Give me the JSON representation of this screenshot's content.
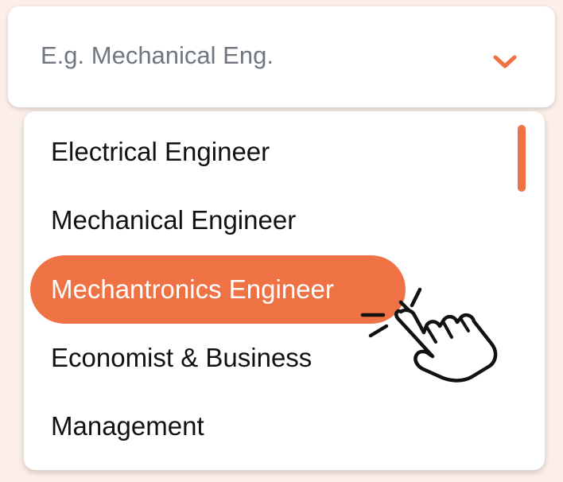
{
  "select": {
    "placeholder": "E.g. Mechanical Eng.",
    "chevron_icon": "chevron-down-icon"
  },
  "dropdown": {
    "options": [
      {
        "label": "Electrical Engineer",
        "selected": false
      },
      {
        "label": "Mechanical Engineer",
        "selected": false
      },
      {
        "label": "Mechantronics Engineer",
        "selected": true
      },
      {
        "label": "Economist & Business",
        "selected": false
      },
      {
        "label": "Management",
        "selected": false
      }
    ],
    "pointer_icon": "hand-pointer-click-icon"
  },
  "colors": {
    "accent": "#ef7244",
    "background": "#fcefe9",
    "placeholder_text": "#6f7780",
    "option_text": "#111111"
  }
}
